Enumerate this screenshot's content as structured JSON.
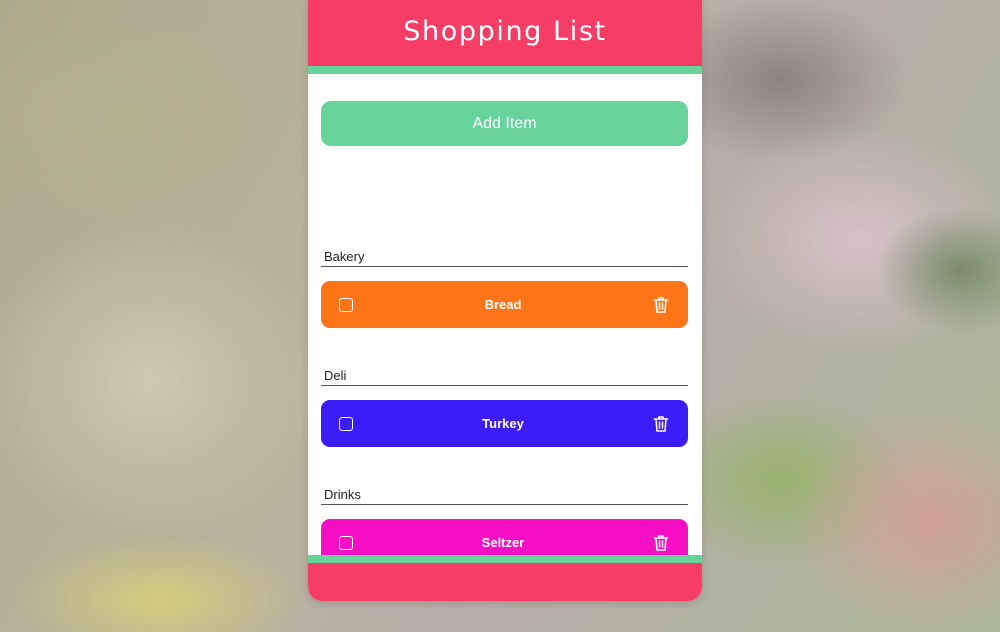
{
  "app": {
    "title": "Shopping List",
    "add_label": "Add Item"
  },
  "colors": {
    "header": "#f53d66",
    "accent": "#67d39a"
  },
  "sections": [
    {
      "name": "Bakery",
      "item": "Bread",
      "color": "#ff7417"
    },
    {
      "name": "Deli",
      "item": "Turkey",
      "color": "#3d1cfa"
    },
    {
      "name": "Drinks",
      "item": "Seltzer",
      "color": "#f60fc4"
    }
  ]
}
